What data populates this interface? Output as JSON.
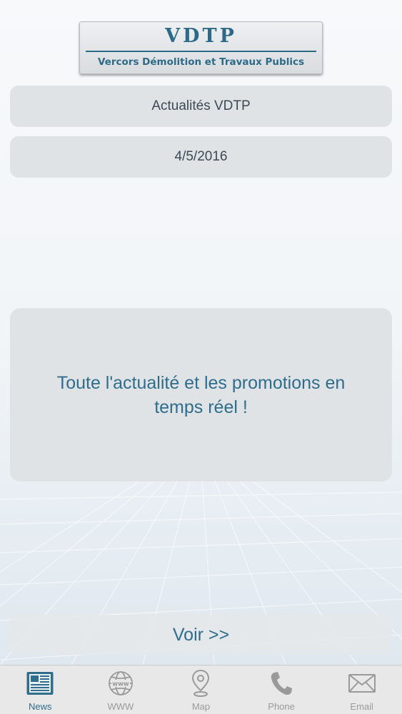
{
  "header": {
    "logo_mark": "VDTP",
    "logo_subtitle": "Vercors Démolition et Travaux Publics"
  },
  "news": {
    "title": "Actualités VDTP",
    "date": "4/5/2016",
    "body": "Toute l'actualité et les promotions en temps réel !",
    "more_button": "Voir >>"
  },
  "tabbar": {
    "active": "News",
    "items": [
      {
        "label": "News",
        "icon": "newspaper-icon"
      },
      {
        "label": "WWW",
        "icon": "globe-icon"
      },
      {
        "label": "Map",
        "icon": "map-pin-icon"
      },
      {
        "label": "Phone",
        "icon": "phone-icon"
      },
      {
        "label": "Email",
        "icon": "envelope-icon"
      }
    ]
  },
  "colors": {
    "accent": "#2f6d8c",
    "pill_bg": "#dee1e4",
    "tab_inactive": "#9a9a9a",
    "tabbar_bg": "#e8e8e8"
  }
}
